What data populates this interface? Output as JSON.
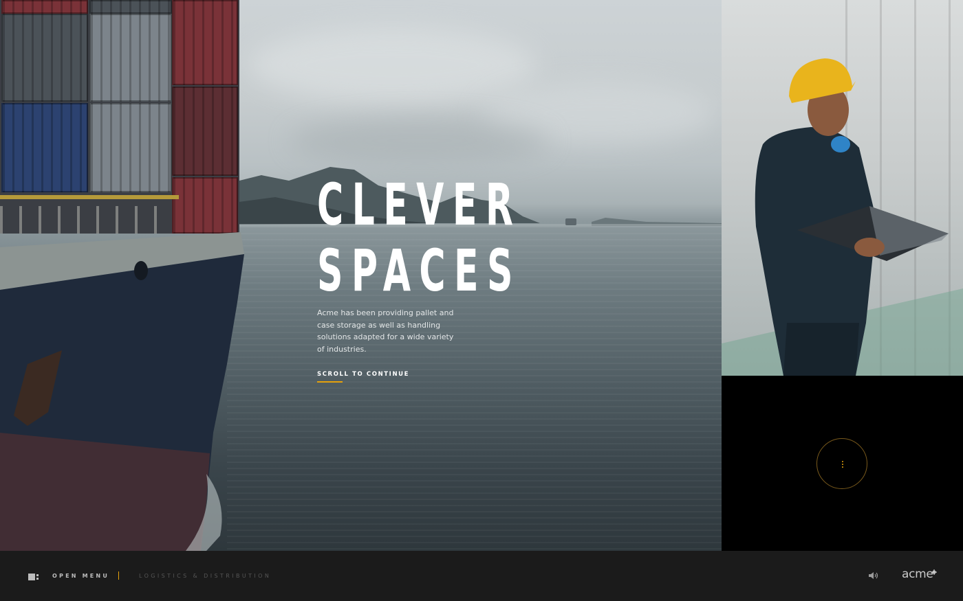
{
  "hero": {
    "title_line1": "CLEVER",
    "title_line2": "SPACES",
    "body": "Acme has been providing pallet and case storage as well as handling solutions adapted for a wide variety of industries.",
    "scroll_cta": "SCROLL TO CONTINUE"
  },
  "footer": {
    "open_menu": "OPEN MENU",
    "section": "LOGISTICS & DISTRIBUTION",
    "logo": "acme"
  },
  "icons": {
    "menu": "menu-icon",
    "sound": "speaker-icon",
    "more": "vertical-dots-icon",
    "logo_mark": "gear-icon"
  },
  "colors": {
    "accent": "#e6a20c",
    "footer_bg": "#1b1b1b",
    "panel_bg": "#000000"
  }
}
